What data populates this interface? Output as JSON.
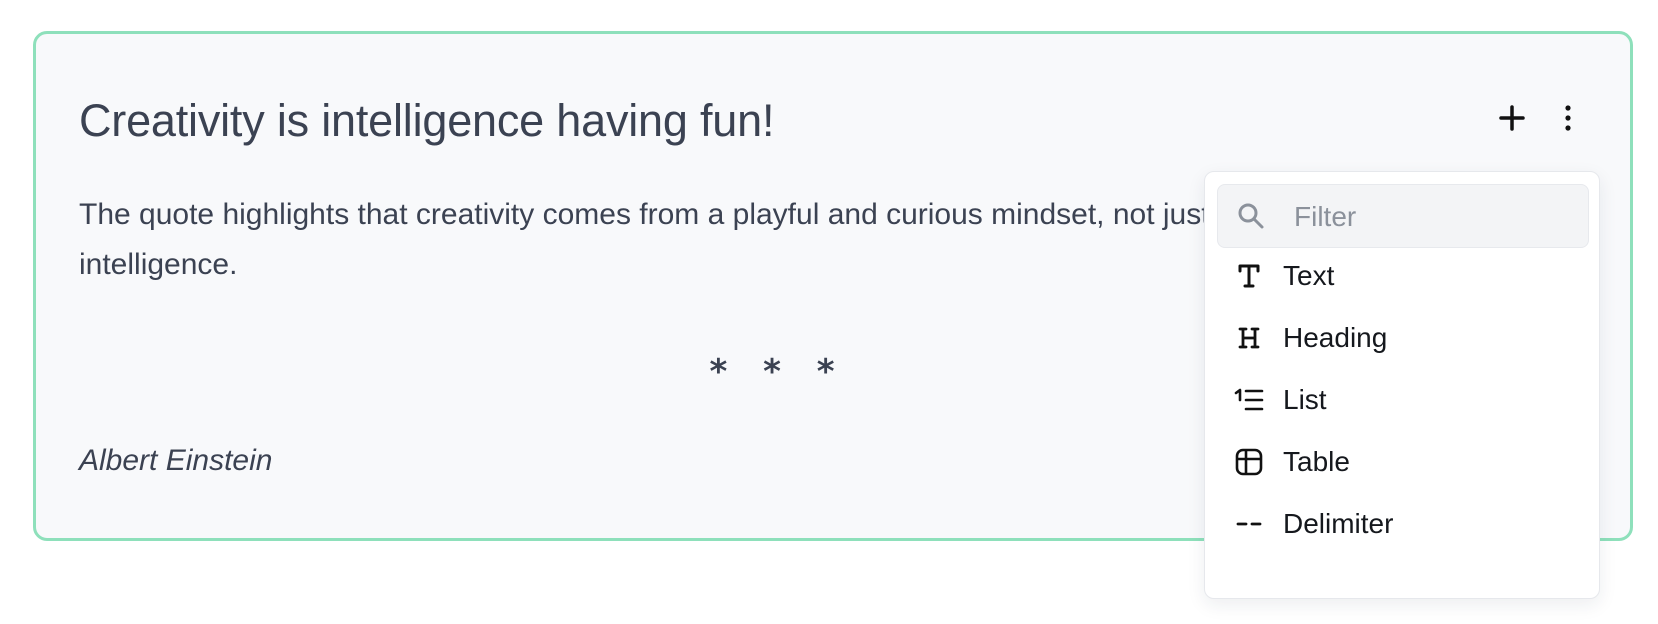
{
  "block": {
    "heading": "Creativity is intelligence having fun!",
    "paragraph": "The quote highlights that creativity comes from a playful and curious mindset, not just intelligence.",
    "delimiter": "* * *",
    "author": "Albert Einstein"
  },
  "toolbar": {
    "add_icon": "plus-icon",
    "more_icon": "vertical-dots-icon"
  },
  "dropdown": {
    "filter_placeholder": "Filter",
    "filter_value": "",
    "items": [
      {
        "label": "Text",
        "icon": "text-icon"
      },
      {
        "label": "Heading",
        "icon": "heading-icon"
      },
      {
        "label": "List",
        "icon": "list-icon"
      },
      {
        "label": "Table",
        "icon": "table-icon"
      },
      {
        "label": "Delimiter",
        "icon": "delimiter-icon"
      }
    ]
  },
  "colors": {
    "accent_border": "#8ee0bb",
    "card_background": "#f8f9fb",
    "text": "#3b4252"
  }
}
